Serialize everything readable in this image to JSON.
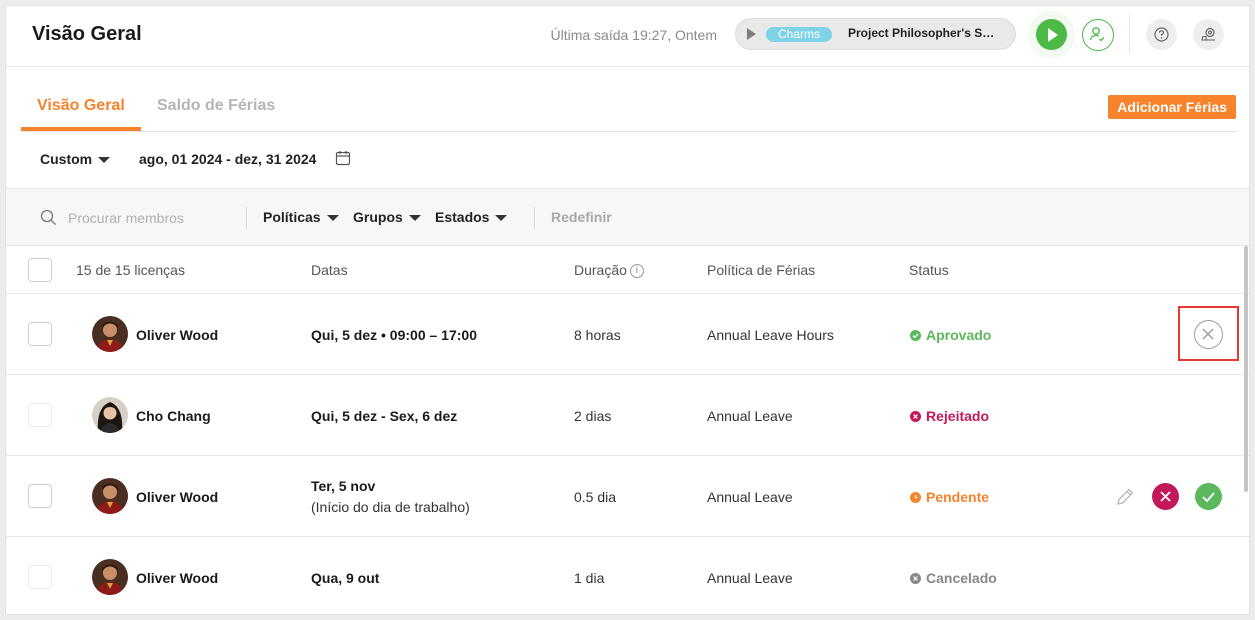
{
  "header": {
    "title": "Visão Geral",
    "last_exit": "Última saída 19:27, Ontem",
    "timer": {
      "tag": "Charms",
      "project": "Project Philosopher's Stone"
    }
  },
  "tabs": [
    {
      "label": "Visão Geral",
      "active": true
    },
    {
      "label": "Saldo de Férias",
      "active": false
    }
  ],
  "add_button": "Adicionar Férias",
  "date_filter": {
    "preset": "Custom",
    "range": "ago, 01 2024 - dez, 31 2024"
  },
  "filters": {
    "search_placeholder": "Procurar membros",
    "policies": "Políticas",
    "groups": "Grupos",
    "states": "Estados",
    "reset": "Redefinir"
  },
  "table": {
    "count_label": "15 de 15 licenças",
    "columns": {
      "dates": "Datas",
      "duration": "Duração",
      "policy": "Política de Férias",
      "status": "Status"
    },
    "rows": [
      {
        "name": "Oliver Wood",
        "dates": "Qui, 5 dez • 09:00 – 17:00",
        "dates_sub": "",
        "duration": "8 horas",
        "policy": "Annual Leave Hours",
        "status": "Aprovado",
        "status_color": "#5cb85c"
      },
      {
        "name": "Cho Chang",
        "dates": "Qui, 5 dez - Sex, 6 dez",
        "dates_sub": "",
        "duration": "2 dias",
        "policy": "Annual Leave",
        "status": "Rejeitado",
        "status_color": "#c2185b"
      },
      {
        "name": "Oliver Wood",
        "dates": "Ter, 5 nov",
        "dates_sub": "(Início do dia de trabalho)",
        "duration": "0.5 dia",
        "policy": "Annual Leave",
        "status": "Pendente",
        "status_color": "#f7832c"
      },
      {
        "name": "Oliver Wood",
        "dates": "Qua, 9 out",
        "dates_sub": "",
        "duration": "1 dia",
        "policy": "Annual Leave",
        "status": "Cancelado",
        "status_color": "#888888"
      }
    ]
  },
  "colors": {
    "accent": "#f7832c",
    "green": "#4cba45",
    "reject": "#c2185b",
    "highlight": "#e53935"
  }
}
